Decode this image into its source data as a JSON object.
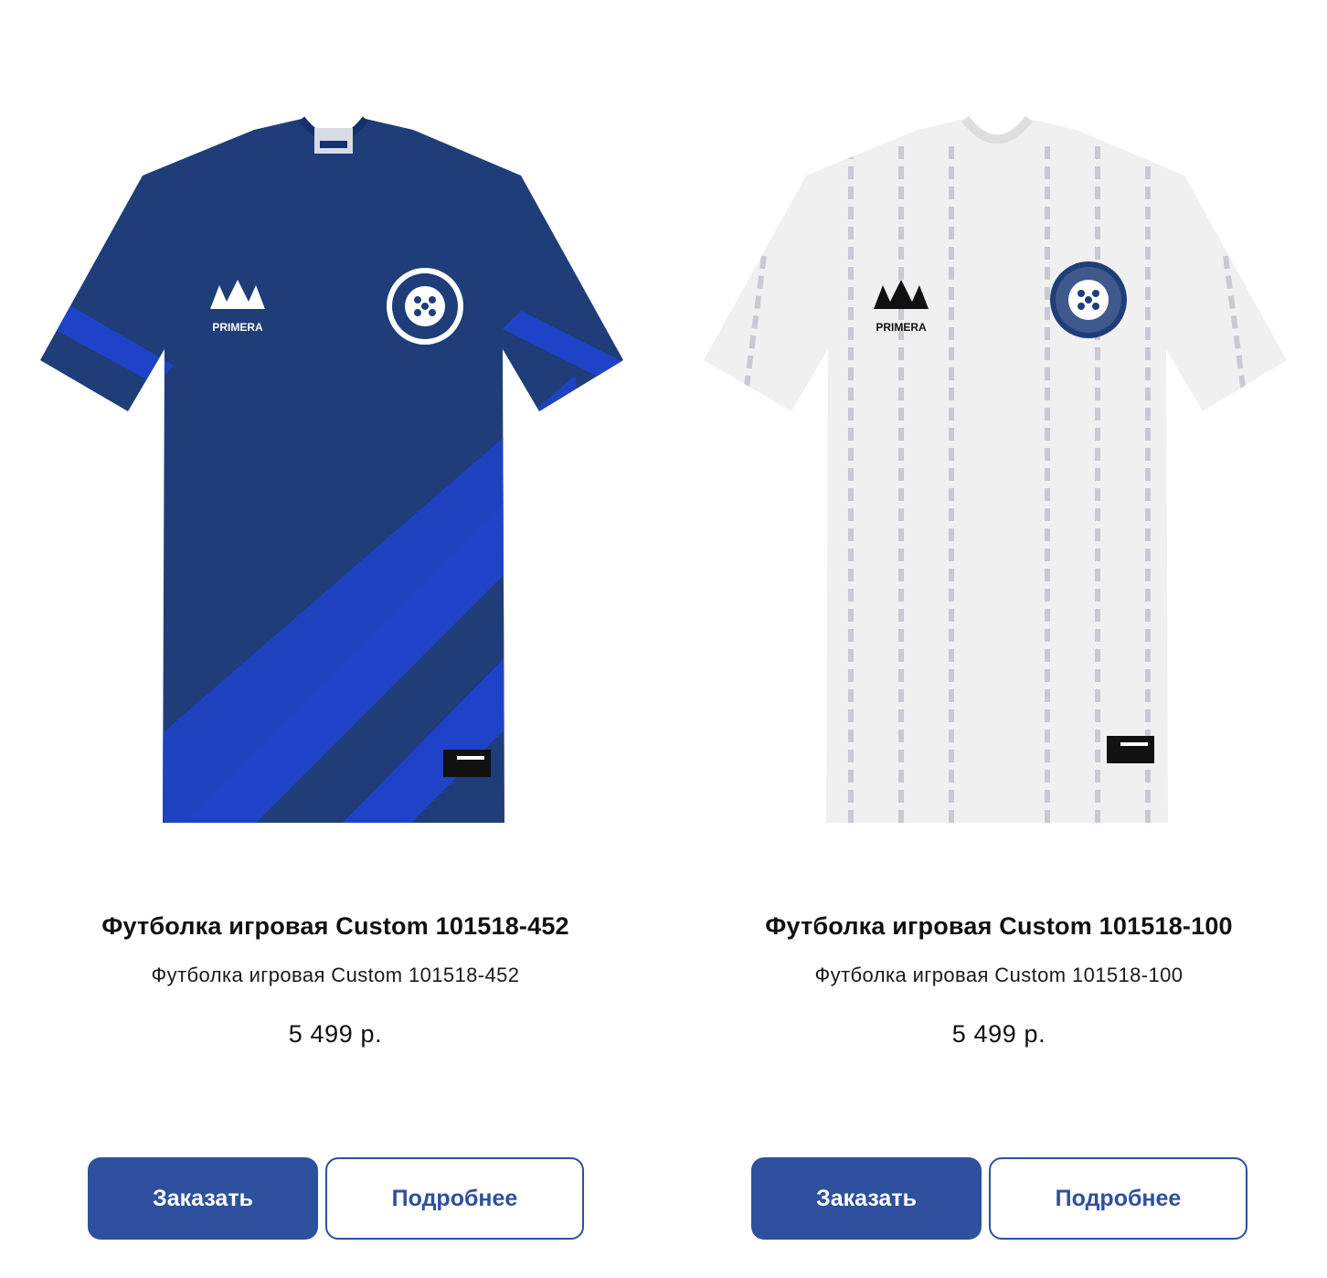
{
  "products": [
    {
      "title": "Футболка игровая Custom 101518-452",
      "description": "Футболка игровая Custom 101518-452",
      "price": "5 499 р.",
      "order_label": "Заказать",
      "details_label": "Подробнее",
      "image": {
        "name": "blue-jersey-image",
        "base_color": "#1f3d78",
        "stripe_color": "#1f43c8"
      }
    },
    {
      "title": "Футболка игровая Custom 101518-100",
      "description": "Футболка игровая Custom 101518-100",
      "price": "5 499 р.",
      "order_label": "Заказать",
      "details_label": "Подробнее",
      "image": {
        "name": "white-jersey-image",
        "base_color": "#f0f0f0",
        "stripe_color": "#c9c9d4"
      }
    }
  ],
  "colors": {
    "accent": "#2e509e",
    "text": "#111111"
  }
}
